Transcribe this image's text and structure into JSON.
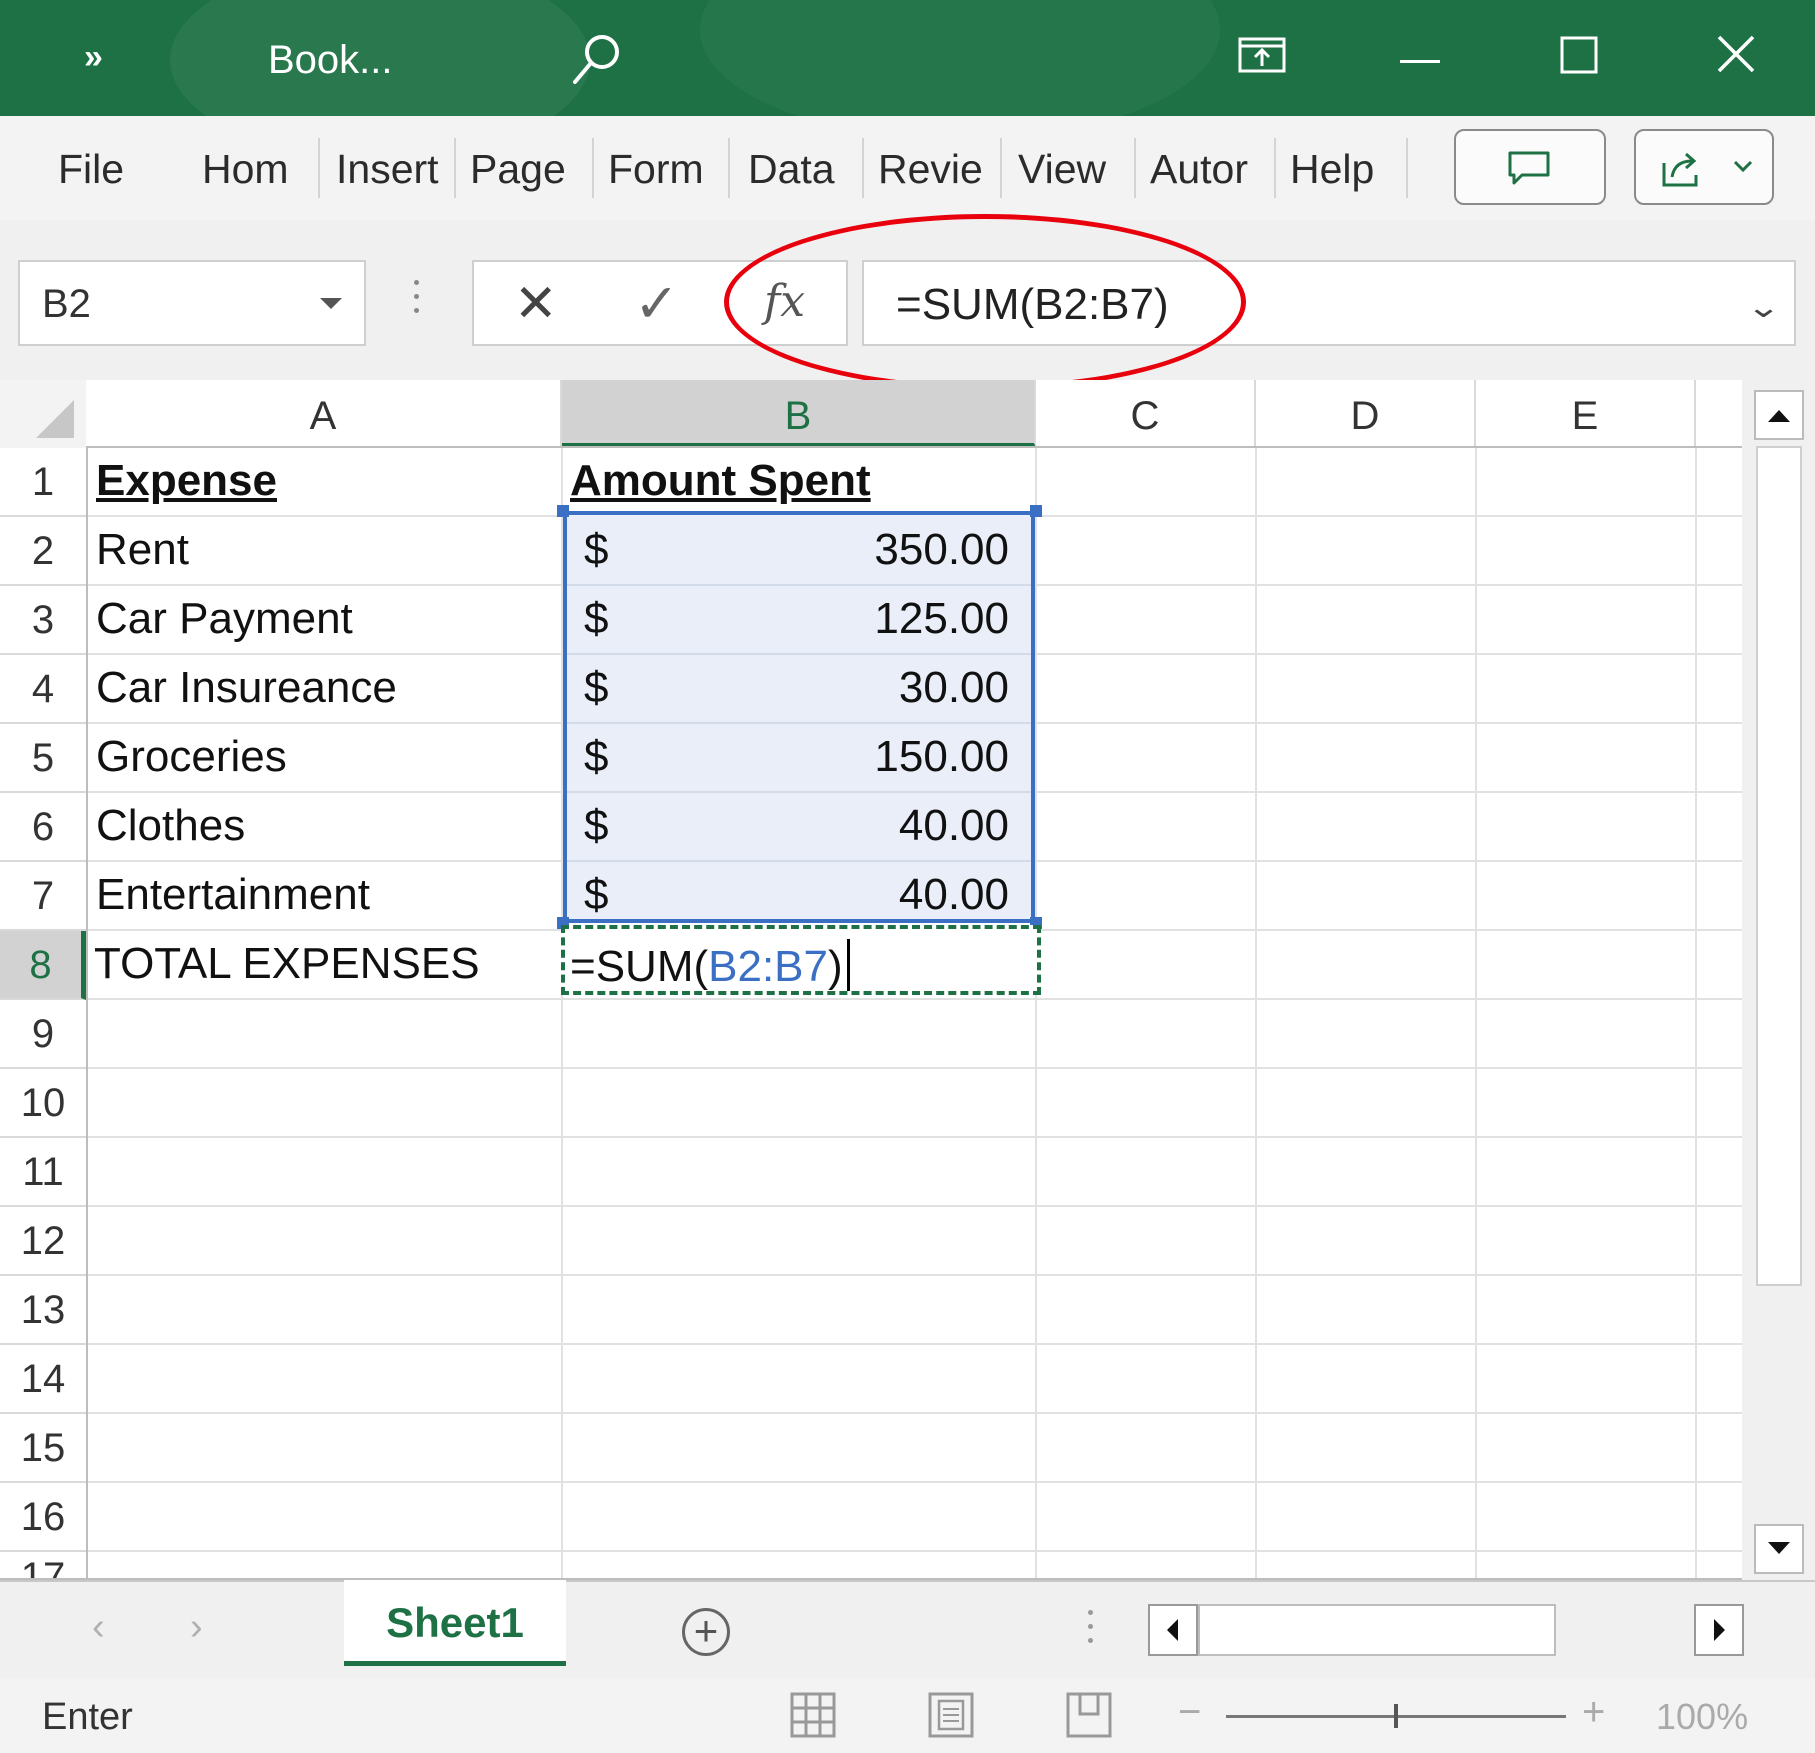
{
  "titlebar": {
    "more_label": "»",
    "title": "Book...",
    "icons": [
      "search-icon",
      "ribbon-display-icon",
      "minimize-icon",
      "maximize-icon",
      "close-icon"
    ]
  },
  "menu": {
    "items": [
      "File",
      "Hom",
      "Insert",
      "Page",
      "Form",
      "Data",
      "Revie",
      "View",
      "Autor",
      "Help"
    ],
    "comment_icon": "comment-icon",
    "share_icon": "share-icon"
  },
  "formula_bar": {
    "name_box": "B2",
    "cancel_glyph": "✕",
    "enter_glyph": "✓",
    "fx_label": "fx",
    "formula": "=SUM(B2:B7)"
  },
  "grid": {
    "columns": [
      "A",
      "B",
      "C",
      "D",
      "E"
    ],
    "selected_column": "B",
    "rows": [
      "1",
      "2",
      "3",
      "4",
      "5",
      "6",
      "7",
      "8",
      "9",
      "10",
      "11",
      "12",
      "13",
      "14",
      "15",
      "16",
      "17"
    ],
    "active_row": "8",
    "headers": {
      "a1": "Expense",
      "b1": "Amount Spent"
    },
    "expenses": [
      {
        "label": "Rent",
        "currency": "$",
        "amount": "350.00"
      },
      {
        "label": "Car Payment",
        "currency": "$",
        "amount": "125.00"
      },
      {
        "label": "Car Insureance",
        "currency": "$",
        "amount": "30.00"
      },
      {
        "label": "Groceries",
        "currency": "$",
        "amount": "150.00"
      },
      {
        "label": "Clothes",
        "currency": "$",
        "amount": "40.00"
      },
      {
        "label": "Entertainment",
        "currency": "$",
        "amount": "40.00"
      }
    ],
    "total_label": "TOTAL EXPENSES",
    "editing_formula": {
      "prefix": "=SUM(",
      "reference": "B2:B7",
      "suffix": ")"
    }
  },
  "sheet_tabs": {
    "tabs": [
      "Sheet1"
    ],
    "add_icon": "add-sheet-icon"
  },
  "status_bar": {
    "mode": "Enter",
    "zoom_minus": "−",
    "zoom_plus": "+",
    "zoom_level": "100%"
  },
  "colors": {
    "brand": "#1e7145",
    "selection": "#3a6fc4",
    "annotation": "#e8000d"
  }
}
